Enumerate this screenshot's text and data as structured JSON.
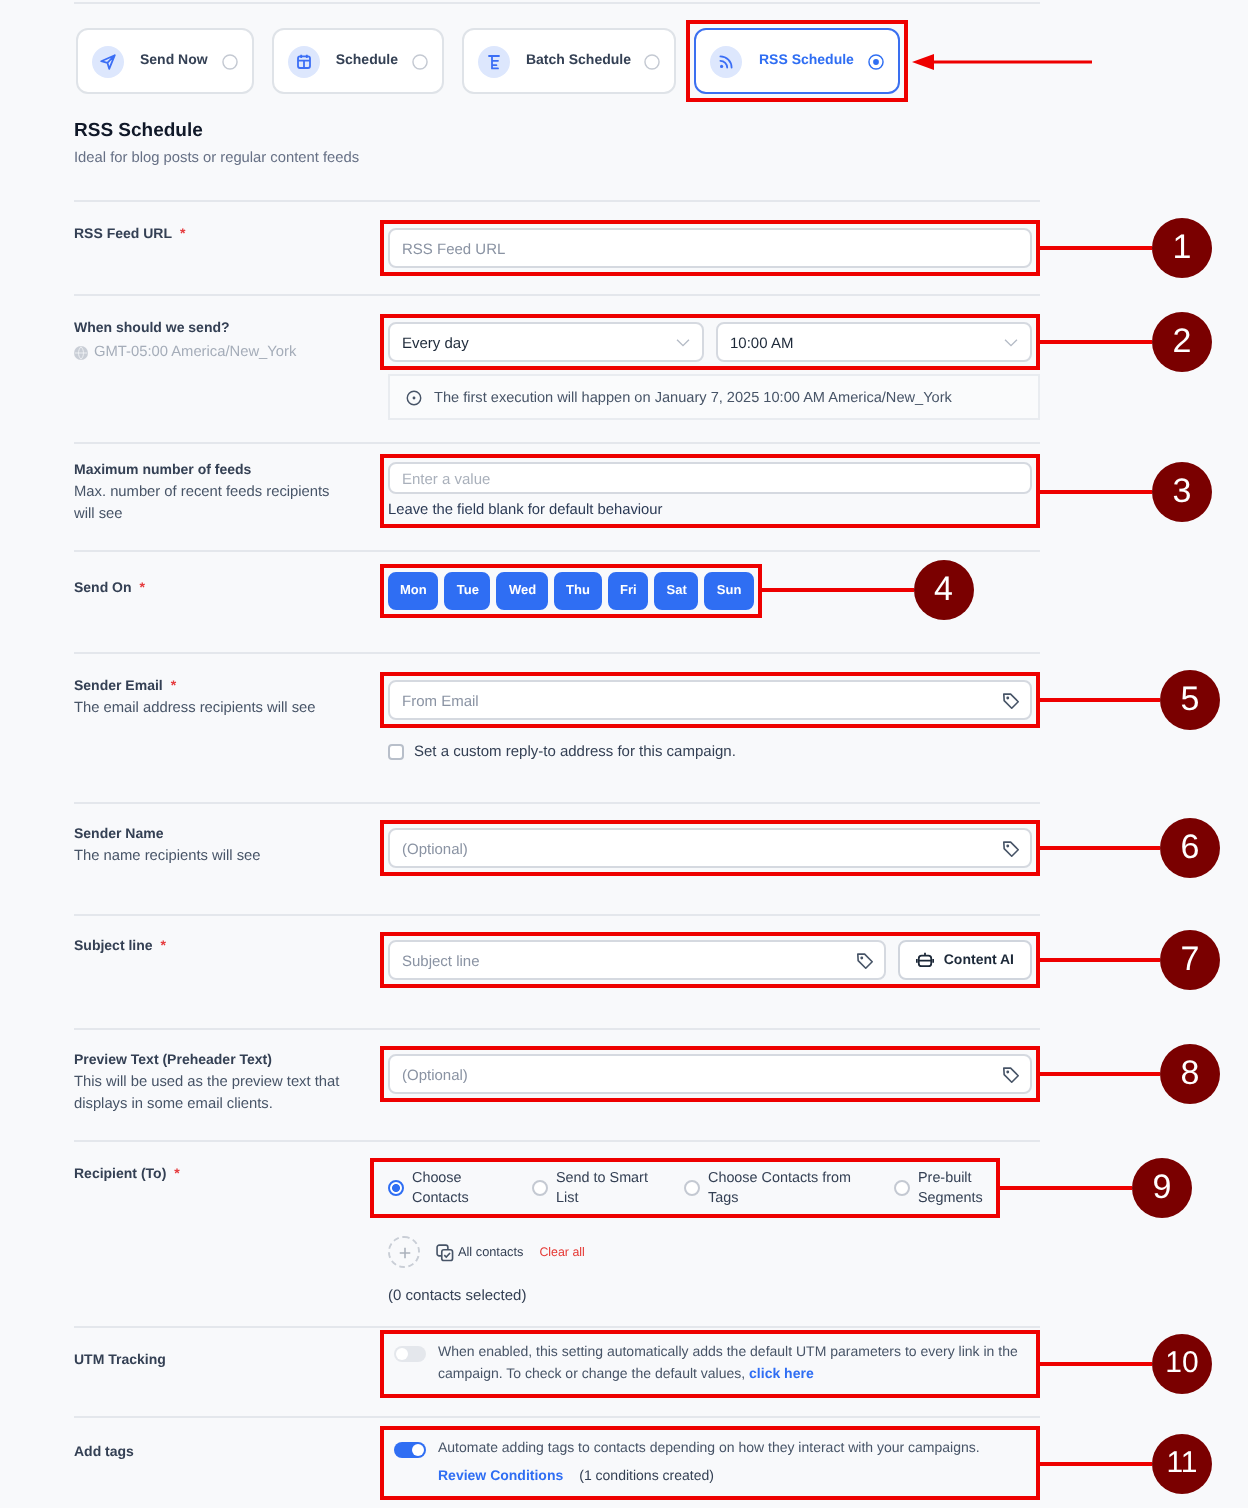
{
  "send_modes": [
    {
      "kind": "send_now",
      "label": "Send Now",
      "selected": false,
      "highlighted": false
    },
    {
      "kind": "schedule",
      "label": "Schedule",
      "selected": false,
      "highlighted": false
    },
    {
      "kind": "batch",
      "label": "Batch Schedule",
      "selected": false,
      "highlighted": false
    },
    {
      "kind": "rss",
      "label": "RSS Schedule",
      "selected": true,
      "highlighted": true
    }
  ],
  "section": {
    "title": "RSS Schedule",
    "subtitle": "Ideal for blog posts or regular content feeds"
  },
  "fields": [
    {
      "kind": "text",
      "label": "RSS Feed URL",
      "required_mark": "*",
      "placeholder": "RSS Feed URL",
      "callout": "1"
    },
    {
      "kind": "schedule",
      "label": "When should we send?",
      "timezone": "GMT-05:00 America/New_York",
      "frequency": "Every day",
      "time": "10:00 AM",
      "note": "The first execution will happen on January 7, 2025 10:00 AM America/New_York",
      "callout": "2"
    },
    {
      "kind": "number",
      "label": "Maximum number of feeds",
      "description": "Max. number of recent feeds recipients will see",
      "placeholder": "Enter a value",
      "hint": "Leave the field blank for default behaviour",
      "callout": "3"
    },
    {
      "kind": "days",
      "label": "Send On",
      "required_mark": "*",
      "days": [
        {
          "label": "Mon",
          "selected": true
        },
        {
          "label": "Tue",
          "selected": true
        },
        {
          "label": "Wed",
          "selected": true
        },
        {
          "label": "Thu",
          "selected": true
        },
        {
          "label": "Fri",
          "selected": true
        },
        {
          "label": "Sat",
          "selected": true
        },
        {
          "label": "Sun",
          "selected": true
        }
      ],
      "callout": "4"
    },
    {
      "kind": "tagged",
      "label": "Sender Email",
      "required_mark": "*",
      "description": "The email address recipients will see",
      "placeholder": "From Email",
      "checkbox": {
        "label": "Set a custom reply-to address for this campaign.",
        "checked": false
      },
      "callout": "5"
    },
    {
      "kind": "tagged",
      "label": "Sender Name",
      "description": "The name recipients will see",
      "placeholder": "(Optional)",
      "callout": "6"
    },
    {
      "kind": "subject",
      "label": "Subject line",
      "required_mark": "*",
      "placeholder": "Subject line",
      "button": "Content AI",
      "callout": "7"
    },
    {
      "kind": "tagged",
      "label": "Preview Text (Preheader Text)",
      "description": "This will be used as the preview text that displays in some email clients.",
      "placeholder": "(Optional)",
      "callout": "8"
    },
    {
      "kind": "recipients",
      "label": "Recipient (To)",
      "required_mark": "*",
      "options": [
        {
          "label": "Choose Contacts",
          "selected": true
        },
        {
          "label": "Send to Smart List",
          "selected": false
        },
        {
          "label": "Choose Contacts from Tags",
          "selected": false
        },
        {
          "label": "Pre-built Segments",
          "selected": false
        }
      ],
      "all_contacts": "All contacts",
      "clear": "Clear all",
      "count": "(0 contacts selected)",
      "callout": "9"
    },
    {
      "kind": "toggle",
      "label": "UTM Tracking",
      "on": false,
      "text": "When enabled, this setting automatically adds the default UTM parameters to every link in the campaign. To check or change the default values, ",
      "link": "click here",
      "callout": "10"
    },
    {
      "kind": "toggle",
      "label": "Add tags",
      "on": true,
      "text": "Automate adding tags to contacts depending on how they interact with your campaigns.",
      "action": {
        "link": "Review Conditions",
        "status": "(1 conditions created)"
      },
      "callout": "11"
    }
  ]
}
